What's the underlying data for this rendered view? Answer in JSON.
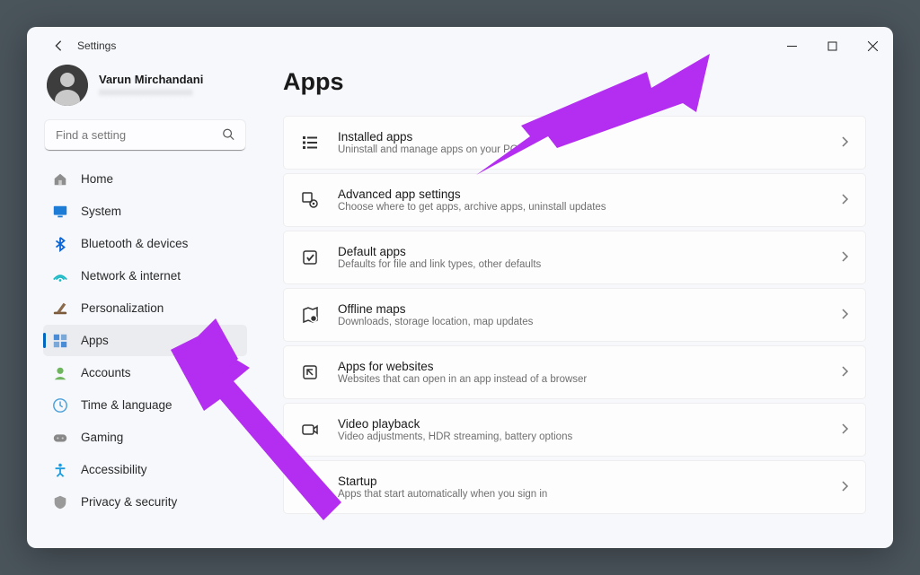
{
  "window": {
    "title": "Settings"
  },
  "profile": {
    "name": "Varun Mirchandani",
    "email": "xxxxxxxxxxxxxxxxxxx"
  },
  "search": {
    "placeholder": "Find a setting"
  },
  "sidebar": {
    "items": [
      {
        "label": "Home",
        "icon": "home"
      },
      {
        "label": "System",
        "icon": "system"
      },
      {
        "label": "Bluetooth & devices",
        "icon": "bluetooth"
      },
      {
        "label": "Network & internet",
        "icon": "network"
      },
      {
        "label": "Personalization",
        "icon": "personalization"
      },
      {
        "label": "Apps",
        "icon": "apps",
        "selected": true
      },
      {
        "label": "Accounts",
        "icon": "accounts"
      },
      {
        "label": "Time & language",
        "icon": "time"
      },
      {
        "label": "Gaming",
        "icon": "gaming"
      },
      {
        "label": "Accessibility",
        "icon": "accessibility"
      },
      {
        "label": "Privacy & security",
        "icon": "privacy"
      }
    ]
  },
  "page": {
    "title": "Apps"
  },
  "cards": [
    {
      "title": "Installed apps",
      "desc": "Uninstall and manage apps on your PC",
      "icon": "list"
    },
    {
      "title": "Advanced app settings",
      "desc": "Choose where to get apps, archive apps, uninstall updates",
      "icon": "gear-app"
    },
    {
      "title": "Default apps",
      "desc": "Defaults for file and link types, other defaults",
      "icon": "default-app"
    },
    {
      "title": "Offline maps",
      "desc": "Downloads, storage location, map updates",
      "icon": "map"
    },
    {
      "title": "Apps for websites",
      "desc": "Websites that can open in an app instead of a browser",
      "icon": "app-website"
    },
    {
      "title": "Video playback",
      "desc": "Video adjustments, HDR streaming, battery options",
      "icon": "video"
    },
    {
      "title": "Startup",
      "desc": "Apps that start automatically when you sign in",
      "icon": "startup"
    }
  ],
  "annotations": {
    "arrow_color": "#b32ef0"
  }
}
